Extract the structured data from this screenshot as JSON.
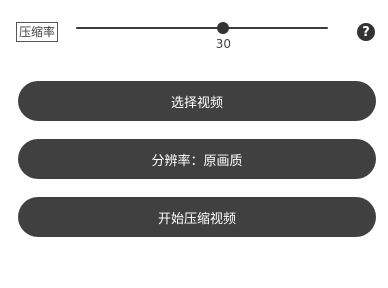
{
  "compression": {
    "label": "压缩率",
    "slider": {
      "value": 30,
      "value_label": "30",
      "fraction": 0.585
    }
  },
  "help": {
    "icon": "help-icon",
    "glyph": "?"
  },
  "buttons": {
    "select_video": "选择视频",
    "resolution": "分辨率：原画质",
    "start_compress": "开始压缩视频"
  }
}
